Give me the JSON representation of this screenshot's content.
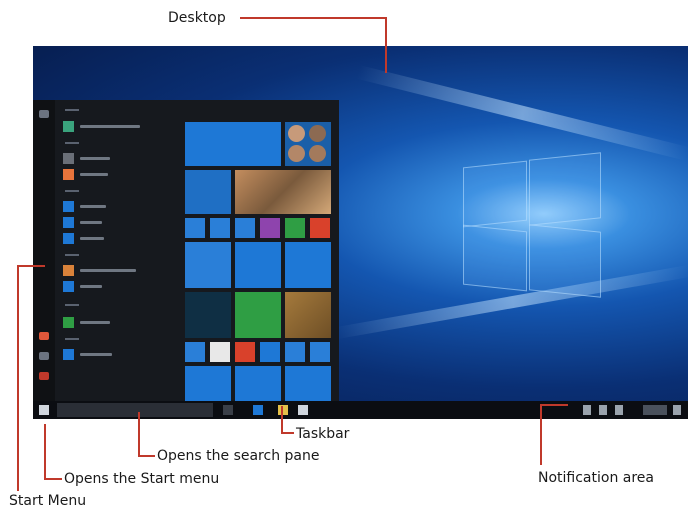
{
  "labels": {
    "desktop": "Desktop",
    "taskbar": "Taskbar",
    "search_pane": "Opens the search pane",
    "start_menu_button": "Opens the Start menu",
    "notification_area": "Notification area",
    "start_menu": "Start Menu"
  },
  "colors": {
    "leader": "#c0392b",
    "start_menu_bg": "#16191e",
    "taskbar_bg": "#0b0d12",
    "tile_blue": "#1e78d6"
  }
}
